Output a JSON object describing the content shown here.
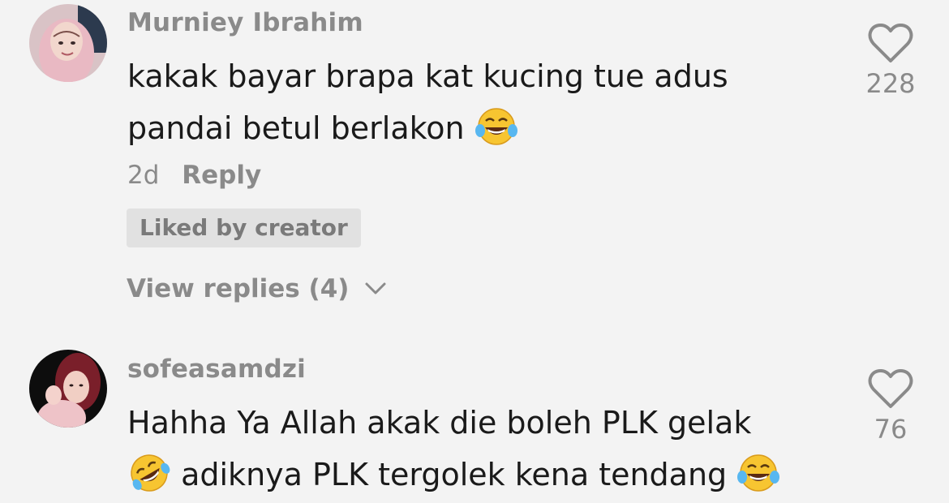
{
  "comments": [
    {
      "username": "Murniey Ibrahim",
      "text_line1": "kakak bayar brapa kat kucing tue adus",
      "text_line2": "pandai betul berlakon",
      "time": "2d",
      "reply_label": "Reply",
      "badge": "Liked by creator",
      "view_replies": "View replies (4)",
      "likes": "228",
      "emoji": [
        "face-with-tears-of-joy"
      ]
    },
    {
      "username": "sofeasamdzi",
      "text_line1": "Hahha Ya Allah akak die boleh PLK gelak",
      "text_line2": "adiknya PLK tergolek kena tendang",
      "likes": "76",
      "emoji": [
        "rolling-on-floor-laughing",
        "face-with-tears-of-joy"
      ]
    }
  ],
  "colors": {
    "background": "#f3f3f3",
    "text": "#1a1a1a",
    "muted": "#8a8a8a",
    "badge_bg": "#e1e1e1"
  }
}
